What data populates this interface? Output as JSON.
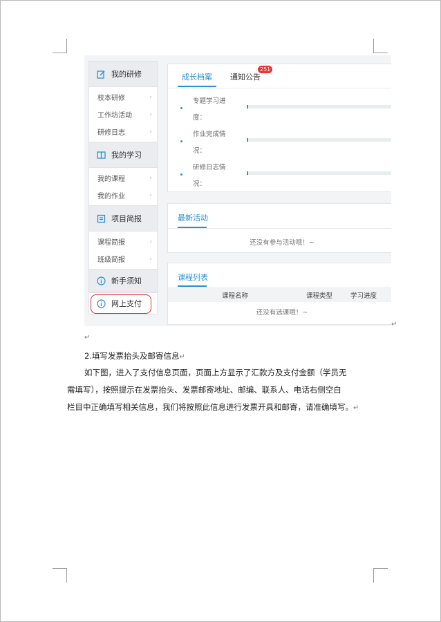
{
  "sidebar": {
    "sections": [
      {
        "title": "我的研修",
        "items": [
          "校本研修",
          "工作坊活动",
          "研修日志"
        ]
      },
      {
        "title": "我的学习",
        "items": [
          "我的课程",
          "我的作业"
        ]
      },
      {
        "title": "项目简报",
        "items": [
          "课程简报",
          "班级简报"
        ]
      }
    ],
    "notice": "新手须知",
    "pay": "网上支付",
    "chevron": "›"
  },
  "growth": {
    "tab_active": "成长档案",
    "tab_notice": "通知公告",
    "badge": "251",
    "rows": [
      {
        "line1": "专题学习进",
        "line2": "度：",
        "value": 0
      },
      {
        "line1": "作业完成情",
        "line2": "况：",
        "value": 0
      },
      {
        "line1": "研修日志情",
        "line2": "况：",
        "value": 0
      }
    ]
  },
  "activity": {
    "title": "最新活动",
    "empty": "还没有参与活动哦！~"
  },
  "courses": {
    "title": "课程列表",
    "columns": [
      "课程名称",
      "课程类型",
      "学习进度"
    ],
    "empty": "还没有选课哦！~"
  },
  "document": {
    "heading": "2.填写发票抬头及邮寄信息",
    "lines": [
      "如下图，进入了支付信息页面，页面上方显示了汇款方及支付金额（学员无",
      "需填写），按照提示在发票抬头、发票邮寄地址、邮编、联系人、电话右侧空白",
      "栏目中正确填写相关信息，我们将按照此信息进行发票开具和邮寄，请准确填写。"
    ],
    "para_mark": "↵"
  }
}
